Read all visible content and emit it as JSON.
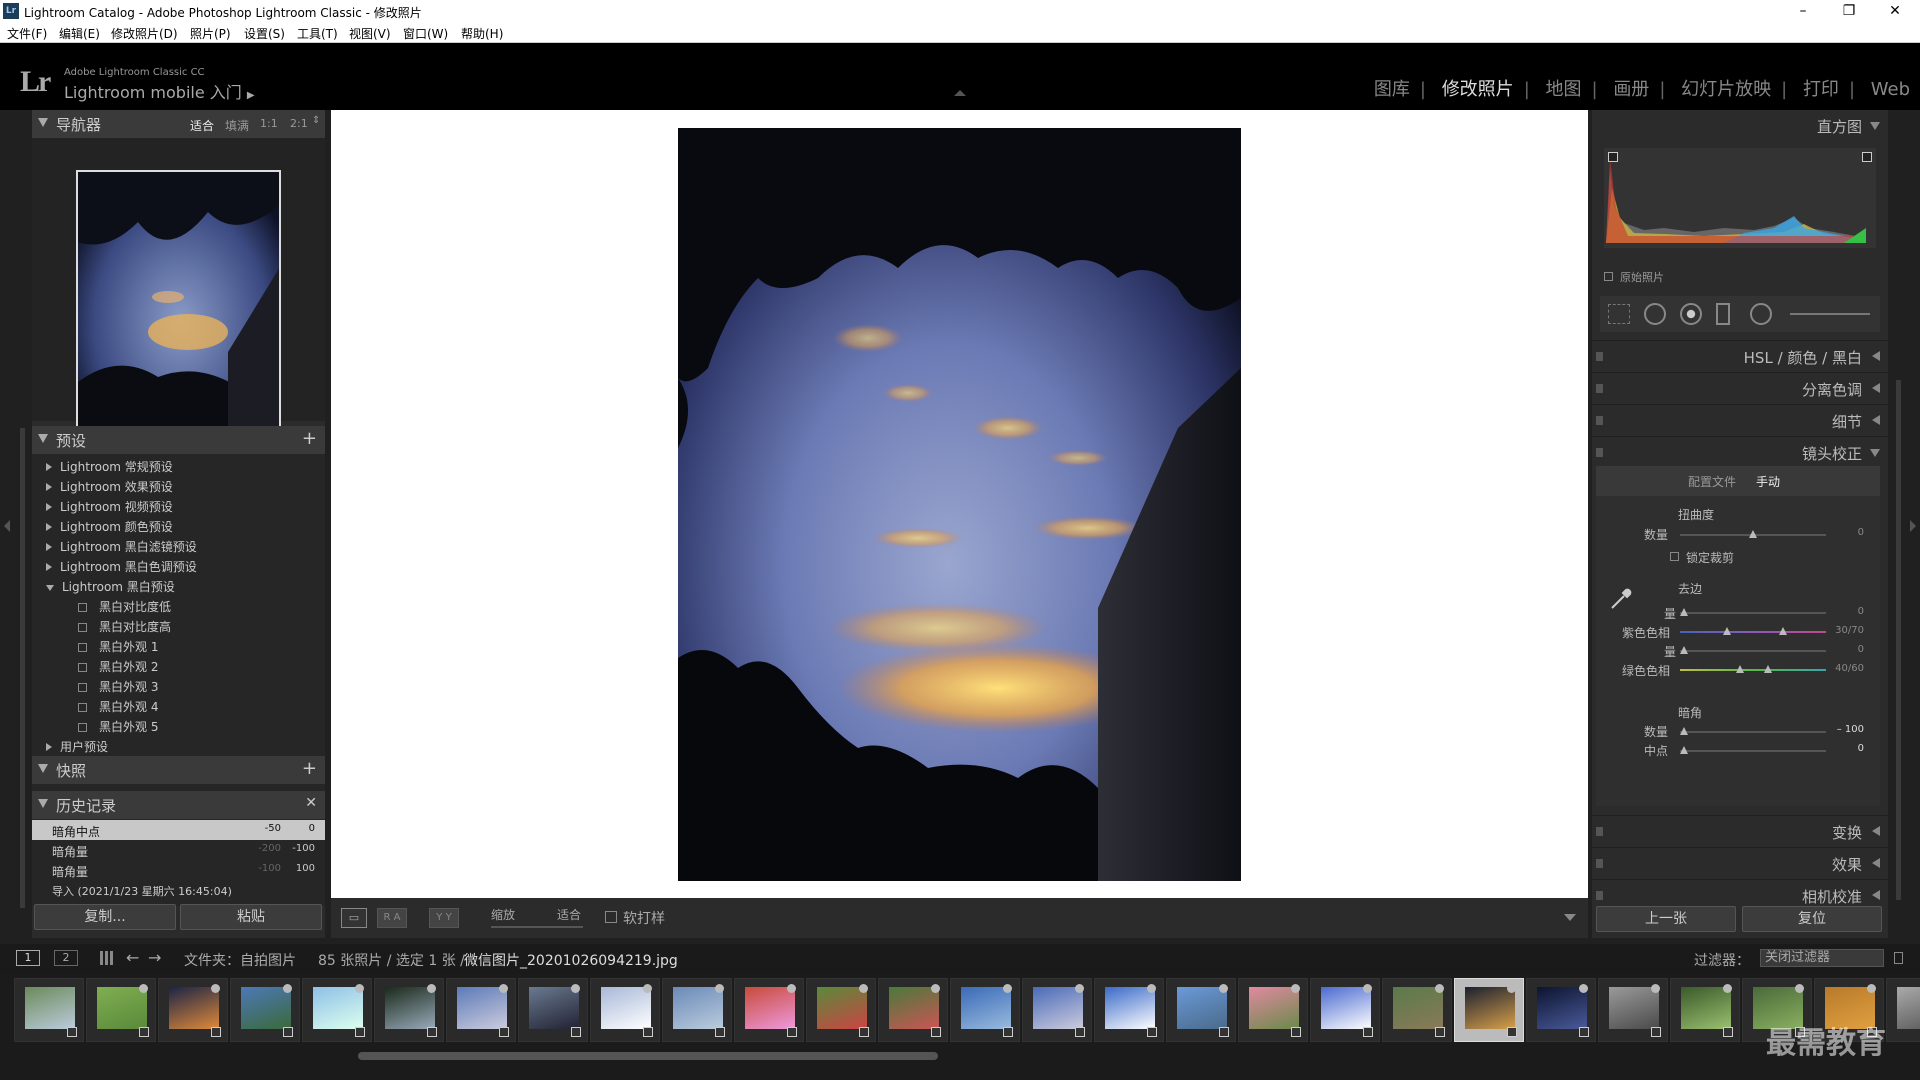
{
  "window": {
    "title": "Lightroom Catalog - Adobe Photoshop Lightroom Classic - 修改照片",
    "minimize": "–",
    "maximize": "❐",
    "close": "✕"
  },
  "menu": [
    "文件(F)",
    "编辑(E)",
    "修改照片(D)",
    "照片(P)",
    "设置(S)",
    "工具(T)",
    "视图(V)",
    "窗口(W)",
    "帮助(H)"
  ],
  "identity": {
    "logo": "Lr",
    "product_line1": "Adobe Lightroom Classic CC",
    "product_line2": "Lightroom mobile 入门"
  },
  "modules": [
    {
      "label": "图库",
      "active": false
    },
    {
      "label": "修改照片",
      "active": true
    },
    {
      "label": "地图",
      "active": false
    },
    {
      "label": "画册",
      "active": false
    },
    {
      "label": "幻灯片放映",
      "active": false
    },
    {
      "label": "打印",
      "active": false
    },
    {
      "label": "Web",
      "active": false
    }
  ],
  "navigator": {
    "title": "导航器",
    "zoom": [
      "适合",
      "填满",
      "1:1",
      "2:1"
    ]
  },
  "presets": {
    "title": "预设",
    "add": "+",
    "groups": [
      {
        "label": "Lightroom 常规预设",
        "expanded": false
      },
      {
        "label": "Lightroom 效果预设",
        "expanded": false
      },
      {
        "label": "Lightroom 视频预设",
        "expanded": false
      },
      {
        "label": "Lightroom 颜色预设",
        "expanded": false
      },
      {
        "label": "Lightroom 黑白滤镜预设",
        "expanded": false
      },
      {
        "label": "Lightroom 黑白色调预设",
        "expanded": false
      },
      {
        "label": "Lightroom 黑白预设",
        "expanded": true
      }
    ],
    "items": [
      "黑白对比度低",
      "黑白对比度高",
      "黑白外观 1",
      "黑白外观 2",
      "黑白外观 3",
      "黑白外观 4",
      "黑白外观 5"
    ],
    "user": "用户预设"
  },
  "snapshots": {
    "title": "快照",
    "add": "+"
  },
  "history": {
    "title": "历史记录",
    "close": "✕",
    "rows": [
      {
        "name": "暗角中点",
        "a": "-50",
        "b": "0",
        "selected": true
      },
      {
        "name": "暗角量",
        "a": "-200",
        "b": "-100",
        "selected": false
      },
      {
        "name": "暗角量",
        "a": "-100",
        "b": "100",
        "selected": false
      },
      {
        "name": "导入 (2021/1/23 星期六 16:45:04)",
        "a": "",
        "b": "",
        "selected": false
      }
    ]
  },
  "left_buttons": {
    "copy": "复制...",
    "paste": "粘贴"
  },
  "toolbar": {
    "zoom_label": "缩放",
    "fit_label": "适合",
    "softproof": "软打样",
    "view1": "▭",
    "view2": "R A",
    "view3": "Y Y"
  },
  "histogram": {
    "title": "直方图",
    "original": "原始照片"
  },
  "right_panels": [
    {
      "label": "HSL / 颜色 / 黑白"
    },
    {
      "label": "分离色调"
    },
    {
      "label": "细节"
    },
    {
      "label": "镜头校正"
    }
  ],
  "lens": {
    "tabs": [
      "配置文件",
      "手动"
    ],
    "active_tab": "手动",
    "distortion_title": "扭曲度",
    "distortion_amount_label": "数量",
    "distortion_amount": "0",
    "distortion_fraction": 0.5,
    "lock_crop": "锁定裁剪",
    "defringe_title": "去边",
    "purple_amount_label": "量",
    "purple_amount": "0",
    "purple_hue_label": "紫色色相",
    "purple_hue": "30/70",
    "green_amount_label": "量",
    "green_amount": "0",
    "green_hue_label": "绿色色相",
    "green_hue": "40/60",
    "vignette_title": "暗角",
    "vignette_amount_label": "数量",
    "vignette_amount": "– 100",
    "vignette_mid_label": "中点",
    "vignette_mid": "0"
  },
  "right_lower_panels": [
    {
      "label": "变换"
    },
    {
      "label": "效果"
    },
    {
      "label": "相机校准"
    }
  ],
  "right_buttons": {
    "prev": "上一张",
    "reset": "复位"
  },
  "filmstrip": {
    "screen1": "1",
    "screen2": "2",
    "source": "文件夹：自拍图片",
    "count": "85 张照片 / 选定 1 张 /",
    "filename": "微信图片_20201026094219.jpg",
    "filter_label": "过滤器：",
    "filter_value": "关闭过滤器"
  },
  "watermark": "最需教育",
  "colors": {
    "bg": "#202020",
    "panel": "#2b2b2b",
    "accent": "#dddddd"
  }
}
